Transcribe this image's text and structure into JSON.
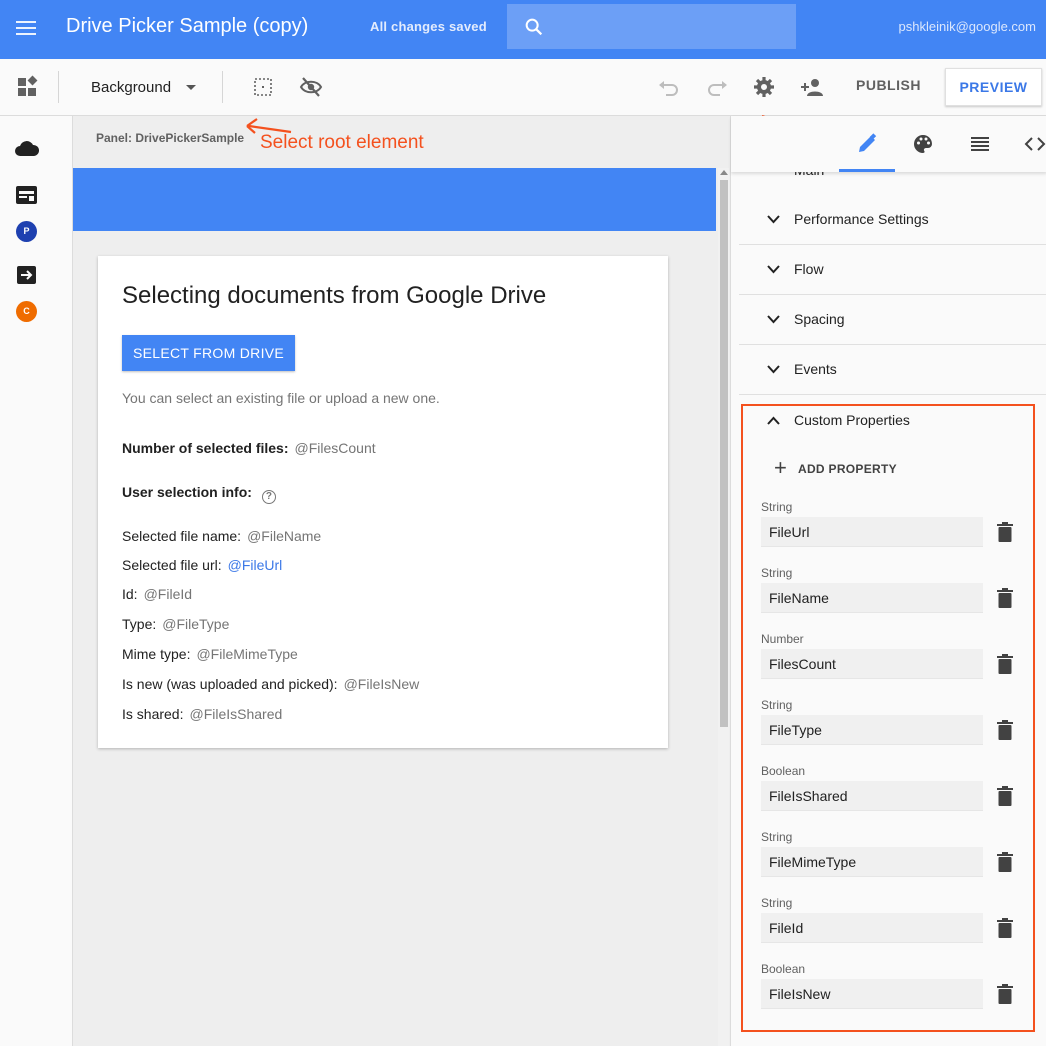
{
  "appbar": {
    "title": "Drive Picker Sample (copy)",
    "save_status": "All changes saved",
    "user_email": "pshkleinik@google.com",
    "colors": {
      "bar": "#4285f4"
    }
  },
  "toolbar": {
    "background_select": "Background",
    "publish_label": "PUBLISH",
    "preview_label": "PREVIEW"
  },
  "rail": {
    "items": [
      {
        "icon": "cloud-icon"
      },
      {
        "icon": "page-icon"
      },
      {
        "letter": "P",
        "color": "#1e40b0"
      },
      {
        "icon": "nav-arrow-icon"
      },
      {
        "letter": "C",
        "color": "#ef6c00"
      }
    ]
  },
  "canvas": {
    "breadcrumb": "Panel: DrivePickerSample",
    "annotation": "Select root element",
    "card": {
      "heading": "Selecting documents from Google Drive",
      "button_label": "SELECT FROM DRIVE",
      "hint": "You can select an existing file or upload a new one.",
      "files_count": {
        "label": "Number of selected files:",
        "value": "@FilesCount"
      },
      "user_selection_label": "User selection info:",
      "fields": [
        {
          "label": "Selected file name:",
          "value": "@FileName"
        },
        {
          "label": "Selected file url:",
          "value": "@FileUrl"
        },
        {
          "label": "Id:",
          "value": "@FileId"
        },
        {
          "label": "Type:",
          "value": "@FileType"
        },
        {
          "label": "Mime type:",
          "value": "@FileMimeType"
        },
        {
          "label": "Is new (was uploaded and picked):",
          "value": "@FileIsNew"
        },
        {
          "label": "Is shared:",
          "value": "@FileIsShared"
        }
      ]
    }
  },
  "property_panel": {
    "tabs": [
      "pencil-icon",
      "palette-icon",
      "list-icon",
      "code-icon"
    ],
    "active_tab": "pencil-icon",
    "sections": {
      "main": "Main",
      "performance": "Performance Settings",
      "flow": "Flow",
      "spacing": "Spacing",
      "events": "Events"
    },
    "custom_properties": {
      "title": "Custom Properties",
      "add_label": "ADD PROPERTY",
      "items": [
        {
          "type": "String",
          "name": "FileUrl"
        },
        {
          "type": "String",
          "name": "FileName"
        },
        {
          "type": "Number",
          "name": "FilesCount"
        },
        {
          "type": "String",
          "name": "FileType"
        },
        {
          "type": "Boolean",
          "name": "FileIsShared"
        },
        {
          "type": "String",
          "name": "FileMimeType"
        },
        {
          "type": "String",
          "name": "FileId"
        },
        {
          "type": "Boolean",
          "name": "FileIsNew"
        }
      ]
    }
  }
}
